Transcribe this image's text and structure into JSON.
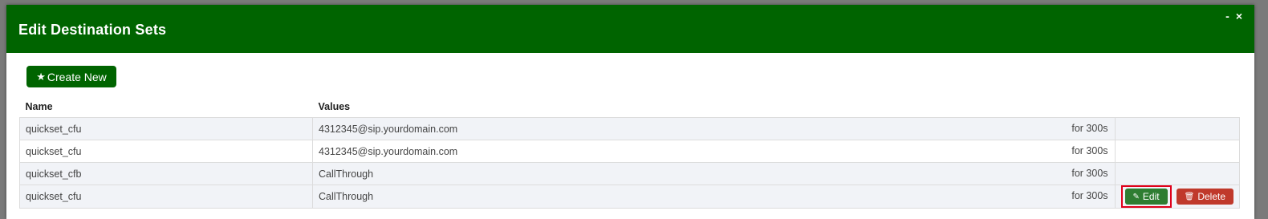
{
  "dialog": {
    "title": "Edit Destination Sets",
    "minimize_label": "-",
    "close_label": "×"
  },
  "toolbar": {
    "create_label": "Create New",
    "create_icon": "star-icon"
  },
  "table": {
    "headers": [
      "Name",
      "Values"
    ],
    "rows": [
      {
        "name": "quickset_cfu",
        "value": "4312345@sip.yourdomain.com",
        "duration": "for 300s"
      },
      {
        "name": "quickset_cfu",
        "value": "4312345@sip.yourdomain.com",
        "duration": "for 300s"
      },
      {
        "name": "quickset_cfb",
        "value": "CallThrough",
        "duration": "for 300s"
      },
      {
        "name": "quickset_cfu",
        "value": "CallThrough",
        "duration": "for 300s"
      }
    ],
    "actions": {
      "edit_label": "Edit",
      "delete_label": "Delete"
    }
  },
  "colors": {
    "header_green": "#006400",
    "edit_green": "#2e7d32",
    "delete_red": "#c0392b",
    "highlight_red": "#e0001b"
  }
}
